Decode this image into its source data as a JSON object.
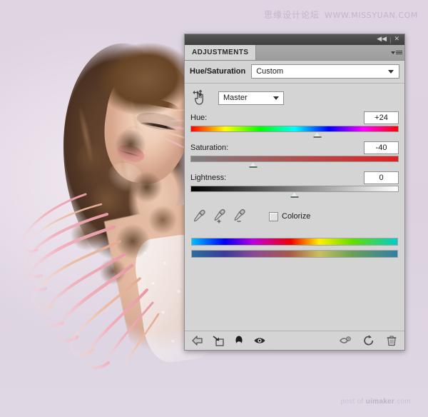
{
  "watermarks": {
    "top_cn": "思缘设计论坛",
    "top_url": "WWW.MISSYUAN.COM",
    "bottom_prefix": "post of ",
    "bottom_brand": "uimaker",
    "bottom_suffix": ".com"
  },
  "panel": {
    "titlebar": {
      "collapse_icon": "double-chevron-left-icon",
      "collapse_glyph": "◀◀",
      "separator": "|",
      "close_glyph": "✕"
    },
    "tab": {
      "label": "ADJUSTMENTS",
      "menu_icon": "panel-menu-icon"
    },
    "preset": {
      "label": "Hue/Saturation",
      "value": "Custom"
    },
    "channel": {
      "oia_icon": "on-image-adjustment-hand-icon",
      "value": "Master"
    },
    "sliders": [
      {
        "name": "hue",
        "label": "Hue:",
        "value": "+24",
        "percent": 61,
        "track": "hue"
      },
      {
        "name": "saturation",
        "label": "Saturation:",
        "value": "-40",
        "percent": 30,
        "track": "sat"
      },
      {
        "name": "lightness",
        "label": "Lightness:",
        "value": "0",
        "percent": 50,
        "track": "light"
      }
    ],
    "tools": {
      "eyedropper": "eyedropper-icon",
      "eyedropper_add": "eyedropper-add-icon",
      "eyedropper_subtract": "eyedropper-subtract-icon",
      "colorize_label": "Colorize",
      "colorize_checked": false
    },
    "range_bars": {
      "top_name": "hue-range-bar-source",
      "bottom_name": "hue-range-bar-result"
    },
    "bottom_toolbar": {
      "left": [
        {
          "name": "return-to-adjustment-list-button",
          "icon": "left-arrow-icon"
        },
        {
          "name": "clip-to-layer-button",
          "icon": "clip-to-layer-icon"
        },
        {
          "name": "toggle-layer-visibility-button",
          "icon": "mask-ellipse-icon"
        },
        {
          "name": "preview-eye-button",
          "icon": "eye-icon"
        }
      ],
      "right": [
        {
          "name": "view-previous-state-button",
          "icon": "eye-previous-icon"
        },
        {
          "name": "reset-adjustment-button",
          "icon": "reset-circular-arrow-icon"
        },
        {
          "name": "delete-adjustment-button",
          "icon": "trash-icon"
        }
      ]
    }
  },
  "colors": {
    "canvas_background": "#ddd3e1",
    "panel_background": "#d4d4d4",
    "titlebar": "#4a4a4a",
    "tabbar": "#a3a3a3",
    "slider_thumb": "#e9eee9",
    "pink_strand": "#eeaab2",
    "hair_brown": "#5c3e2a"
  }
}
